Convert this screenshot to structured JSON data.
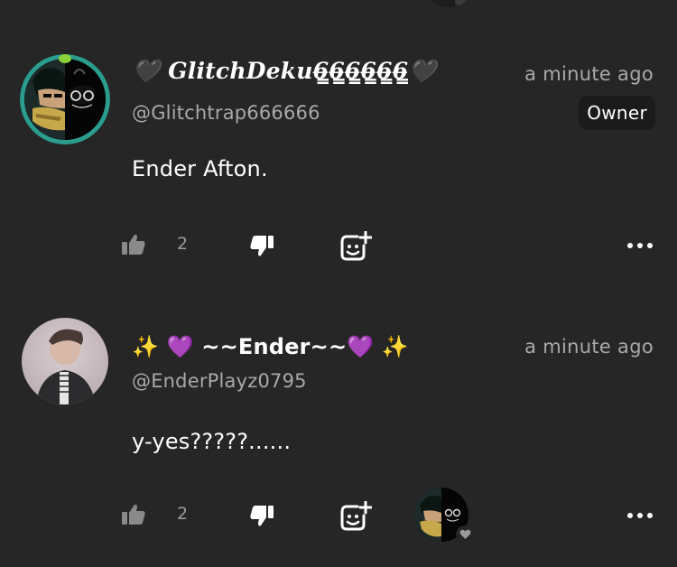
{
  "theme": {
    "background": "#262626",
    "text_primary": "#ffffff",
    "text_secondary": "#a9a9a9",
    "badge_bg": "#1b1b1b",
    "avatar_ring": "#2a9d8f"
  },
  "comments": [
    {
      "display_name": "🖤 𝑮𝒍𝒊𝒕𝒄𝒉𝑫𝒆𝒌𝒖6̶̳6̶̳6̶̳6̶̳6̶̳6̶̳🖤",
      "username": "@Glitchtrap666666",
      "timestamp": "a minute ago",
      "badge": "Owner",
      "text": "Ender Afton.",
      "likes": "2",
      "icons": [
        "thumbs-up-icon",
        "thumbs-down-icon",
        "add-sticker-icon",
        "more-icon"
      ]
    },
    {
      "display_name": "✨ 💜 ~~Ender~~💜 ✨",
      "username": "@EnderPlayz0795",
      "timestamp": "a minute ago",
      "text": "y-yes?????......",
      "likes": "2",
      "icons": [
        "thumbs-up-icon",
        "thumbs-down-icon",
        "add-sticker-icon",
        "reacted-user-avatar",
        "heart-icon",
        "more-icon"
      ]
    }
  ]
}
